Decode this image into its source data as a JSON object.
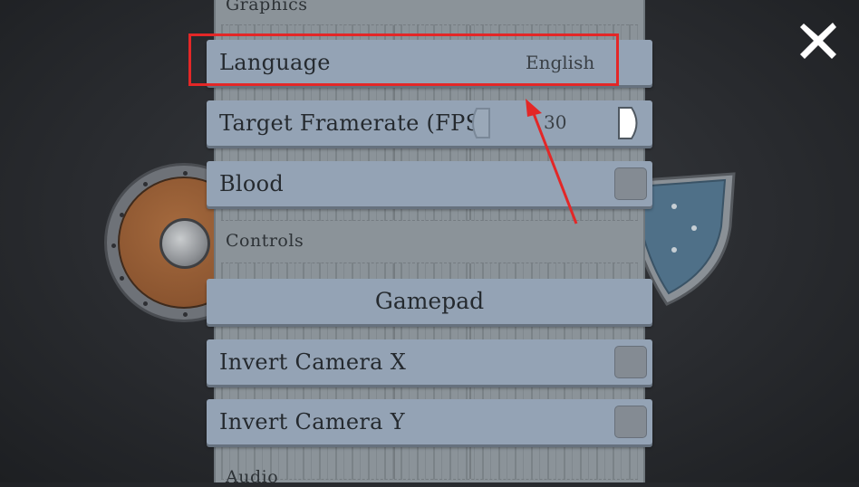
{
  "sections": {
    "graphics": "Graphics",
    "controls": "Controls",
    "audio": "Audio"
  },
  "settings": {
    "language": {
      "label": "Language",
      "value": "English"
    },
    "framerate": {
      "label": "Target Framerate (FPS)",
      "value": "30"
    },
    "blood": {
      "label": "Blood",
      "checked": false
    },
    "gamepad": {
      "label": "Gamepad"
    },
    "invert_x": {
      "label": "Invert Camera X",
      "checked": false
    },
    "invert_y": {
      "label": "Invert Camera Y",
      "checked": false
    }
  },
  "icons": {
    "close": "close-icon",
    "prev": "arrow-left-icon",
    "next": "arrow-right-icon"
  },
  "colors": {
    "highlight": "#e32727",
    "row_bg": "#94a3b5",
    "panel_bg": "#8b9399"
  }
}
